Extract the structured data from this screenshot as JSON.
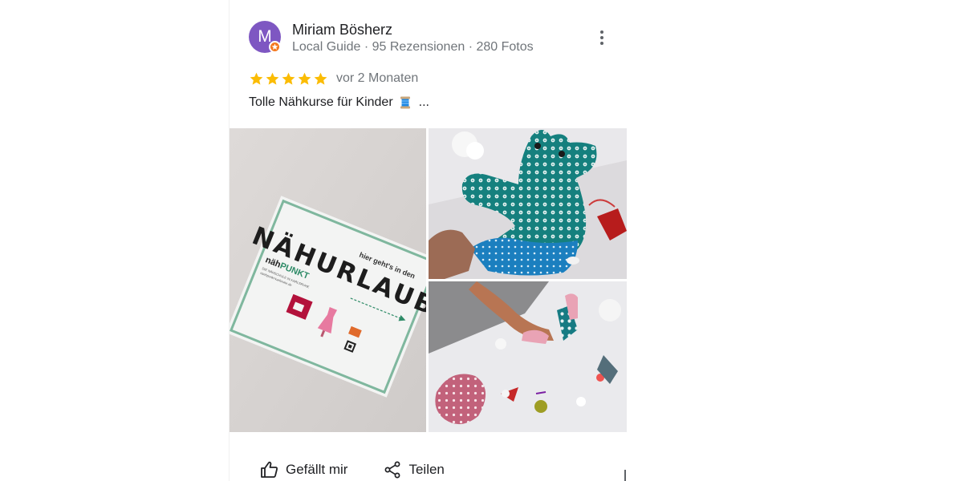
{
  "review": {
    "author": {
      "initial": "M",
      "name": "Miriam Bösherz",
      "meta": "Local Guide · 95 Rezensionen · 280 Fotos"
    },
    "rating": 5,
    "date": "vor 2 Monaten",
    "text": "Tolle Nähkurse für Kinder",
    "text_emoji": "spool-of-thread-icon",
    "more_label": "..."
  },
  "photos": {
    "sign": {
      "headline": "NÄHURLAUB",
      "arrow_text": "hier geht's in den",
      "brand_prefix": "näh",
      "brand_main": "PUNKT",
      "brand_tagline": "DIE NÄHSCHULE IN KARLSRUHE",
      "brand_url": "naehpunkt-karlsruhe.de"
    }
  },
  "actions": {
    "like_label": "Gefällt mir",
    "share_label": "Teilen"
  },
  "colors": {
    "avatar": "#7e57c2",
    "badge": "#f4791f",
    "star": "#fbbc04",
    "secondary_text": "#70757a"
  }
}
